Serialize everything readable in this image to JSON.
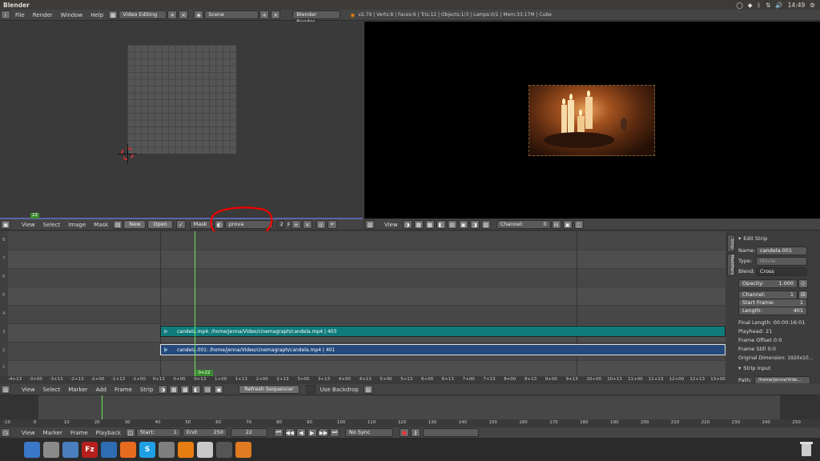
{
  "os": {
    "app_title": "Blender",
    "clock": "14:49"
  },
  "info_header": {
    "menus": [
      "File",
      "Render",
      "Window",
      "Help"
    ],
    "layout": "Video Editing",
    "scene": "Scene",
    "engine": "Blender Render",
    "stats": "v2.79 | Verts:8 | Faces:6 | Tris:12 | Objects:1/3 | Lamps:0/1 | Mem:33.17M | Cube"
  },
  "uv_editor": {
    "frame_marker": "22",
    "menus": [
      "View",
      "Select",
      "Image",
      "Mask"
    ],
    "new_label": "New",
    "open_label": "Open",
    "mode": "Mask",
    "mask_name": "prova",
    "mask_users": "2",
    "f_label": "F"
  },
  "preview": {
    "menu": "View",
    "channel_label": "Channel:",
    "channel_value": "0"
  },
  "sequencer": {
    "strips": [
      {
        "label": "candela.mp4: /home/jenna/Video/cinemagraph/candela.mp4 | 403",
        "color": "#0f7b7b"
      },
      {
        "label": "candela.001: /home/jenna/Video/cinemagraph/candela.mp4 | 401",
        "color": "#24497a"
      }
    ],
    "channel_numbers": [
      "8",
      "7",
      "6",
      "5",
      "4",
      "3",
      "2",
      "1"
    ],
    "playhead_label": "0+22",
    "ruler_ticks": [
      "-4+13",
      "-3+00",
      "-3+13",
      "-2+13",
      "-2+00",
      "-1+13",
      "-1+00",
      "0+13",
      "0+00",
      "0+13",
      "1+00",
      "1+13",
      "2+00",
      "2+13",
      "3+00",
      "3+13",
      "4+00",
      "4+13",
      "5+00",
      "5+13",
      "6+00",
      "6+13",
      "7+00",
      "7+13",
      "8+00",
      "8+13",
      "9+00",
      "9+13",
      "10+00",
      "10+13",
      "11+00",
      "11+13",
      "12+00",
      "12+13",
      "13+00",
      "13+13"
    ],
    "header_menus": [
      "View",
      "Select",
      "Marker",
      "Add",
      "Frame",
      "Strip"
    ],
    "refresh_label": "Refresh Sequencer",
    "backdrop_label": "Use Backdrop"
  },
  "properties": {
    "tab_strip": "Strip",
    "tab_modifiers": "Modifiers",
    "edit_strip_title": "Edit Strip",
    "name_label": "Name:",
    "name_value": "candela.001",
    "type_label": "Type:",
    "type_value": "Movie",
    "blend_label": "Blend:",
    "blend_value": "Cross",
    "opacity_label": "Opacity:",
    "opacity_value": "1.000",
    "channel_label": "Channel:",
    "channel_value": "1",
    "start_label": "Start Frame:",
    "start_value": "1",
    "length_label": "Length:",
    "length_value": "401",
    "final_length": "Final Length: 00:00:16:01",
    "playhead": "Playhead: 21",
    "frame_offset": "Frame Offset 0:0",
    "frame_still": "Frame Still 0:0",
    "original_dim": "Original Dimension: 1920x10...",
    "strip_input_title": "Strip Input",
    "path_label": "Path:",
    "path_value": "/home/jenna/Vide..."
  },
  "timeline": {
    "ticks": [
      "-10",
      "0",
      "10",
      "20",
      "30",
      "40",
      "50",
      "60",
      "70",
      "80",
      "90",
      "100",
      "110",
      "120",
      "130",
      "140",
      "150",
      "160",
      "170",
      "180",
      "190",
      "200",
      "210",
      "220",
      "230",
      "240",
      "250",
      "260"
    ],
    "menus": [
      "View",
      "Marker",
      "Frame",
      "Playback"
    ],
    "start_label": "Start:",
    "start_value": "1",
    "end_label": "End:",
    "end_value": "250",
    "current_frame": "22",
    "sync": "No Sync"
  },
  "dock": {
    "icons": [
      "files-icon",
      "settings-icon",
      "disk-icon",
      "filezilla-icon",
      "vscode-icon",
      "firefox-icon",
      "skype-icon",
      "drive-icon",
      "vlc-icon",
      "monitor-icon",
      "media-icon",
      "blender-icon"
    ],
    "labels": [
      "",
      "",
      "",
      "Fz",
      "",
      "",
      "S",
      "",
      "",
      "",
      "",
      ""
    ],
    "colors": [
      "#3a77c8",
      "#8a8a8a",
      "#4a7fbf",
      "#b5201d",
      "#2e6db3",
      "#e76b1f",
      "#1fa0e4",
      "#7f7f7f",
      "#e57d10",
      "#c8c8c8",
      "#555555",
      "#e07b22"
    ]
  }
}
